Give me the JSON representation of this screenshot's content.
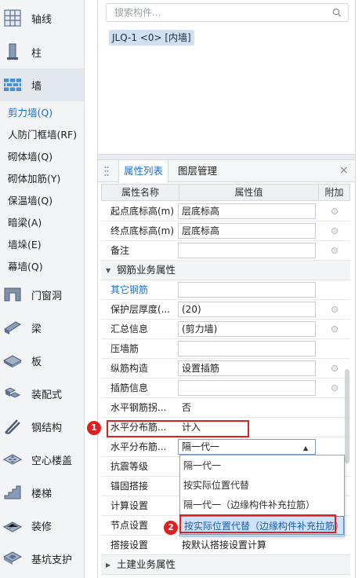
{
  "sidebar": {
    "categories": [
      {
        "label": "轴线",
        "icon": "grid-axis-icon"
      },
      {
        "label": "柱",
        "icon": "column-icon"
      },
      {
        "label": "墙",
        "icon": "wall-icon"
      },
      {
        "label": "门窗洞",
        "icon": "door-window-icon"
      },
      {
        "label": "梁",
        "icon": "beam-icon"
      },
      {
        "label": "板",
        "icon": "slab-icon"
      },
      {
        "label": "装配式",
        "icon": "prefab-icon"
      },
      {
        "label": "钢结构",
        "icon": "steel-structure-icon"
      },
      {
        "label": "空心楼盖",
        "icon": "hollow-floor-icon"
      },
      {
        "label": "楼梯",
        "icon": "stair-icon"
      },
      {
        "label": "装修",
        "icon": "decoration-icon"
      },
      {
        "label": "基坑支护",
        "icon": "foundation-pit-icon"
      }
    ],
    "wall_subitems": [
      "剪力墙(Q)",
      "人防门框墙(RF)",
      "砌体墙(Q)",
      "砌体加筋(Y)",
      "保温墙(Q)",
      "暗梁(A)",
      "墙垛(E)",
      "幕墙(Q)"
    ]
  },
  "search": {
    "placeholder": "搜索构件..."
  },
  "member": {
    "tag": "JLQ-1 <0> [内墙]"
  },
  "tabs": {
    "properties": "属性列表",
    "layers": "图层管理",
    "close": "×"
  },
  "table": {
    "headers": {
      "name": "属性名称",
      "value": "属性值",
      "extra": "附加"
    },
    "rows_top": [
      {
        "name": "起点底标高(m)",
        "value": "层底标高"
      },
      {
        "name": "终点底标高(m)",
        "value": "层底标高"
      },
      {
        "name": "备注",
        "value": ""
      }
    ],
    "group_rebar": "钢筋业务属性",
    "rows_rebar": [
      {
        "name": "其它钢筋",
        "value": ""
      },
      {
        "name": "保护层厚度(...",
        "value": "(20)"
      },
      {
        "name": "汇总信息",
        "value": "(剪力墙)"
      },
      {
        "name": "压墙筋",
        "value": ""
      },
      {
        "name": "纵筋构造",
        "value": "设置插筋"
      },
      {
        "name": "插筋信息",
        "value": ""
      },
      {
        "name": "水平钢筋拐...",
        "value": "否"
      },
      {
        "name": "水平分布筋...",
        "value": "计入"
      },
      {
        "name": "水平分布筋...",
        "value": "隔一代一"
      },
      {
        "name": "抗震等级",
        "value": ""
      },
      {
        "name": "锚固搭接",
        "value": ""
      },
      {
        "name": "计算设置",
        "value": ""
      },
      {
        "name": "节点设置",
        "value": ""
      },
      {
        "name": "搭接设置",
        "value": "按默认搭接设置计算"
      }
    ],
    "group_civil": "土建业务属性"
  },
  "dropdown": {
    "options": [
      "隔一代一",
      "按实际位置代替",
      "隔一代一（边缘构件补充拉筋）",
      "按实际位置代替（边缘构件补充拉筋）"
    ],
    "selected_index": 3
  },
  "callouts": {
    "one": "1",
    "two": "2"
  },
  "colors": {
    "accent": "#1a6fd0",
    "callout": "#e02020",
    "selected_option": "#cfe2f7"
  }
}
